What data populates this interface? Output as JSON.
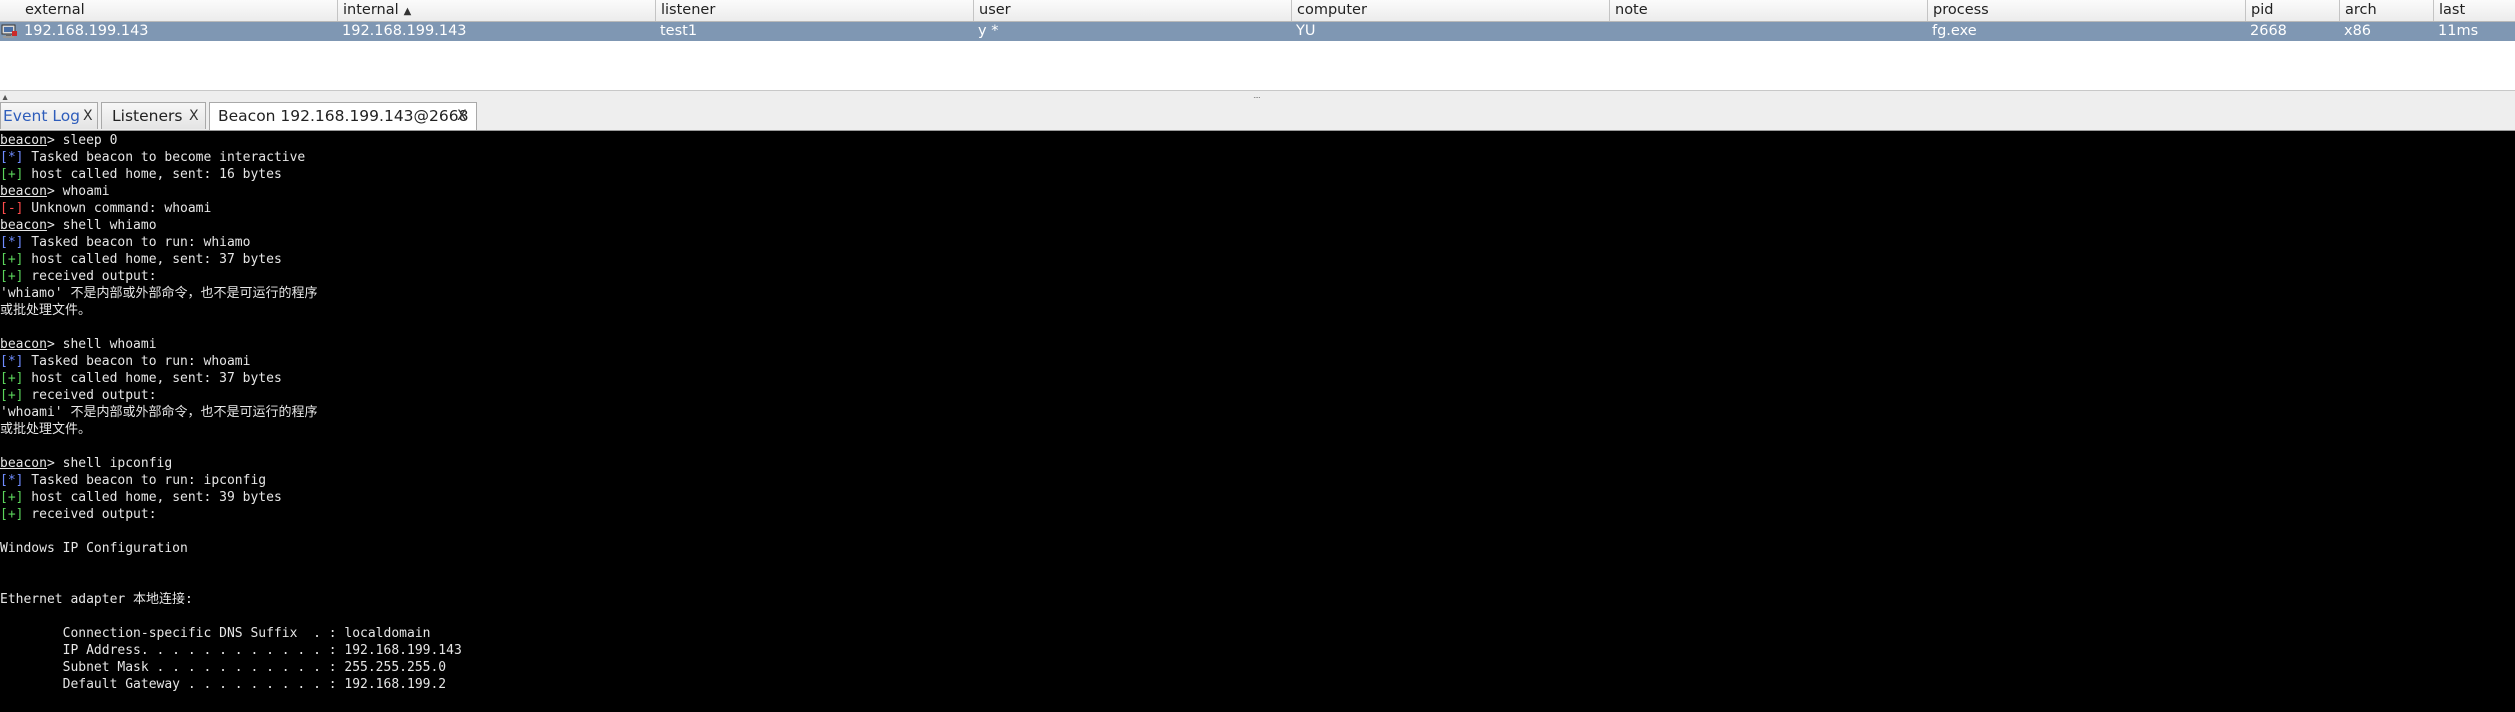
{
  "table": {
    "columns": [
      {
        "label": "external",
        "sorted": false
      },
      {
        "label": "internal",
        "sorted": true,
        "sort_symbol": "▲"
      },
      {
        "label": "listener",
        "sorted": false
      },
      {
        "label": "user",
        "sorted": false
      },
      {
        "label": "computer",
        "sorted": false
      },
      {
        "label": "note",
        "sorted": false
      },
      {
        "label": "process",
        "sorted": false
      },
      {
        "label": "pid",
        "sorted": false
      },
      {
        "label": "arch",
        "sorted": false
      },
      {
        "label": "last",
        "sorted": false
      }
    ],
    "rows": [
      {
        "icon": "computer-beacon-icon",
        "cells": [
          "192.168.199.143",
          "192.168.199.143",
          "test1",
          "y *",
          "YU",
          "",
          "fg.exe",
          "2668",
          "x86",
          "11ms"
        ]
      }
    ]
  },
  "splitter": {
    "arrows": "▲\n▼",
    "grip": "::::"
  },
  "tabs": [
    {
      "label": "Event Log",
      "close": "X",
      "active": false
    },
    {
      "label": "Listeners",
      "close": "X",
      "active": false
    },
    {
      "label": "Beacon 192.168.199.143@2668",
      "close": "X",
      "active": true
    }
  ],
  "console": {
    "prompt": "beacon",
    "lines": [
      {
        "kind": "prompt",
        "text": "> sleep 0"
      },
      {
        "kind": "info",
        "tag": "[*]",
        "text": " Tasked beacon to become interactive"
      },
      {
        "kind": "ok",
        "tag": "[+]",
        "text": " host called home, sent: 16 bytes"
      },
      {
        "kind": "prompt",
        "text": "> whoami"
      },
      {
        "kind": "err",
        "tag": "[-]",
        "text": " Unknown command: whoami"
      },
      {
        "kind": "prompt",
        "text": "> shell whiamo"
      },
      {
        "kind": "info",
        "tag": "[*]",
        "text": " Tasked beacon to run: whiamo"
      },
      {
        "kind": "ok",
        "tag": "[+]",
        "text": " host called home, sent: 37 bytes"
      },
      {
        "kind": "ok",
        "tag": "[+]",
        "text": " received output:"
      },
      {
        "kind": "text",
        "text": "'whiamo' 不是内部或外部命令，也不是可运行的程序"
      },
      {
        "kind": "text",
        "text": "或批处理文件。"
      },
      {
        "kind": "text",
        "text": ""
      },
      {
        "kind": "prompt",
        "text": "> shell whoami"
      },
      {
        "kind": "info",
        "tag": "[*]",
        "text": " Tasked beacon to run: whoami"
      },
      {
        "kind": "ok",
        "tag": "[+]",
        "text": " host called home, sent: 37 bytes"
      },
      {
        "kind": "ok",
        "tag": "[+]",
        "text": " received output:"
      },
      {
        "kind": "text",
        "text": "'whoami' 不是内部或外部命令，也不是可运行的程序"
      },
      {
        "kind": "text",
        "text": "或批处理文件。"
      },
      {
        "kind": "text",
        "text": ""
      },
      {
        "kind": "prompt",
        "text": "> shell ipconfig"
      },
      {
        "kind": "info",
        "tag": "[*]",
        "text": " Tasked beacon to run: ipconfig"
      },
      {
        "kind": "ok",
        "tag": "[+]",
        "text": " host called home, sent: 39 bytes"
      },
      {
        "kind": "ok",
        "tag": "[+]",
        "text": " received output:"
      },
      {
        "kind": "text",
        "text": ""
      },
      {
        "kind": "text",
        "text": "Windows IP Configuration"
      },
      {
        "kind": "text",
        "text": ""
      },
      {
        "kind": "text",
        "text": ""
      },
      {
        "kind": "text",
        "text": "Ethernet adapter 本地连接:"
      },
      {
        "kind": "text",
        "text": ""
      },
      {
        "kind": "text",
        "text": "        Connection-specific DNS Suffix  . : localdomain"
      },
      {
        "kind": "text",
        "text": "        IP Address. . . . . . . . . . . . : 192.168.199.143"
      },
      {
        "kind": "text",
        "text": "        Subnet Mask . . . . . . . . . . . : 255.255.255.0"
      },
      {
        "kind": "text",
        "text": "        Default Gateway . . . . . . . . . : 192.168.199.2"
      }
    ]
  },
  "colors": {
    "selected_row": "#7f97b3",
    "console_bg": "#000000",
    "info_tag": "#6f8cff",
    "ok_tag": "#5bd45b",
    "err_tag": "#ff4b4b"
  }
}
